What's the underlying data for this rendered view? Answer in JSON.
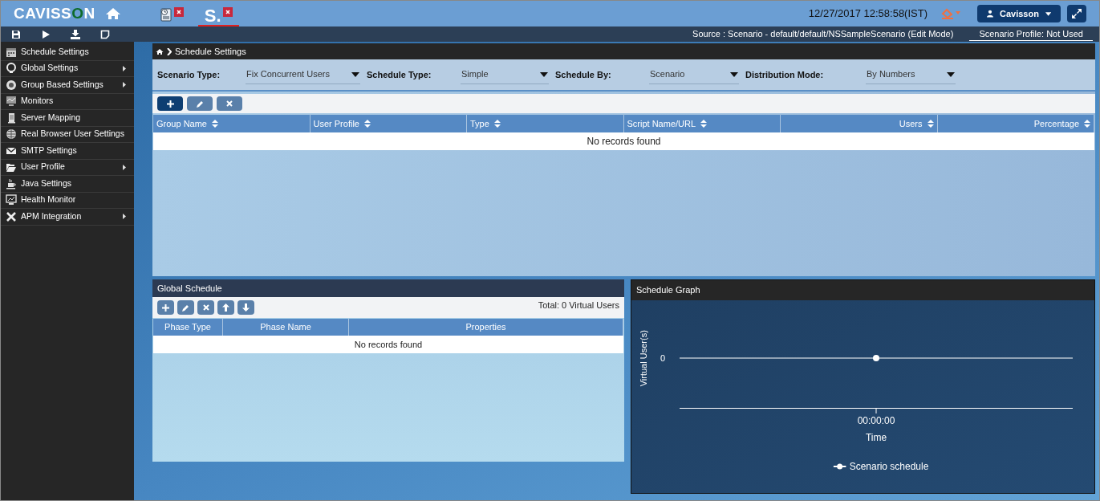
{
  "header": {
    "logo": "CAVISSON",
    "tabs": [
      {
        "selected": false
      },
      {
        "label": "S.",
        "selected": true
      }
    ],
    "datetime": "12/27/2017 12:58:58(IST)",
    "user": "Cavisson"
  },
  "toolbar": {
    "source": "Source : Scenario - default/default/NSSampleScenario (Edit Mode)",
    "profile": "Scenario Profile: Not Used"
  },
  "sidebar": {
    "items": [
      {
        "label": "Schedule Settings",
        "submenu": false,
        "selected": false
      },
      {
        "label": "Global Settings",
        "submenu": true,
        "selected": false
      },
      {
        "label": "Group Based Settings",
        "submenu": true,
        "selected": false
      },
      {
        "label": "Monitors",
        "submenu": false,
        "selected": false
      },
      {
        "label": "Server Mapping",
        "submenu": false,
        "selected": false
      },
      {
        "label": "Real Browser User Settings",
        "submenu": false,
        "selected": false
      },
      {
        "label": "SMTP Settings",
        "submenu": false,
        "selected": false
      },
      {
        "label": "User Profile",
        "submenu": true,
        "selected": false
      },
      {
        "label": "Java Settings",
        "submenu": false,
        "selected": false
      },
      {
        "label": "Health Monitor",
        "submenu": false,
        "selected": false
      },
      {
        "label": "APM Integration",
        "submenu": true,
        "selected": false
      }
    ]
  },
  "breadcrumb": "Schedule Settings",
  "filters": [
    {
      "label": "Scenario Type:",
      "value": "Fix Concurrent Users"
    },
    {
      "label": "Schedule Type:",
      "value": "Simple"
    },
    {
      "label": "Schedule By:",
      "value": "Scenario"
    },
    {
      "label": "Distribution Mode:",
      "value": "By Numbers"
    }
  ],
  "groups_table": {
    "columns": [
      "Group Name",
      "User Profile",
      "Type",
      "Script Name/URL",
      "Users",
      "Percentage"
    ],
    "empty": "No records found"
  },
  "global_schedule": {
    "title": "Global Schedule",
    "total": "Total: 0 Virtual Users",
    "columns": [
      "Phase Type",
      "Phase Name",
      "Properties"
    ],
    "empty": "No records found"
  },
  "schedule_graph": {
    "title": "Schedule Graph",
    "y_axis_title": "Virtual User(s)",
    "y_tick": "0",
    "x_tick": "00:00:00",
    "x_axis_title": "Time",
    "legend": "Scenario schedule"
  }
}
